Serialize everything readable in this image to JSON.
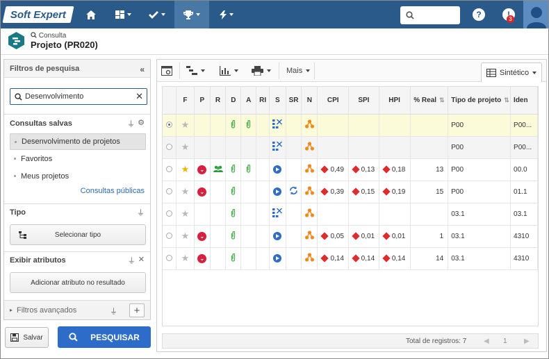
{
  "brand": {
    "logo_text": "Soft Expert"
  },
  "topnav": {
    "items": [
      {
        "icon": "home-icon"
      },
      {
        "icon": "dashboard-icon"
      },
      {
        "icon": "check-icon"
      },
      {
        "icon": "trophy-icon"
      },
      {
        "icon": "lightning-icon"
      }
    ],
    "notification_count": "3"
  },
  "header": {
    "breadcrumb": "Consulta",
    "title": "Projeto (PR020)"
  },
  "left": {
    "title": "Filtros de pesquisa",
    "search_value": "Desenvolvimento",
    "saved_title": "Consultas salvas",
    "saved_items": [
      "Desenvolvimento de projetos",
      "Favoritos",
      "Meus projetos"
    ],
    "public_link": "Consultas públicas",
    "tipo_title": "Tipo",
    "select_type": "Selecionar tipo",
    "attr_title": "Exibir atributos",
    "add_attr": "Adicionar atributo no resultado",
    "advanced": "Filtros avançados",
    "save": "Salvar",
    "search": "PESQUISAR"
  },
  "toolbar": {
    "more": "Mais",
    "view": "Sintético"
  },
  "table": {
    "columns": [
      "",
      "F",
      "P",
      "R",
      "D",
      "A",
      "RI",
      "S",
      "SR",
      "N",
      "CPI",
      "SPI",
      "HPI",
      "% Real",
      "Tipo de projeto",
      "Iden"
    ],
    "rows": [
      {
        "sel": true,
        "star": false,
        "p": false,
        "r": false,
        "d": true,
        "a": true,
        "s": "grid",
        "sr": false,
        "n": true,
        "cpi": "",
        "spi": "",
        "hpi": "",
        "real": "",
        "tipo": "P00",
        "iden": "P00..."
      },
      {
        "sel": false,
        "star": false,
        "p": false,
        "r": false,
        "d": false,
        "a": false,
        "s": "grid",
        "sr": false,
        "n": true,
        "cpi": "",
        "spi": "",
        "hpi": "",
        "real": "",
        "tipo": "P00",
        "iden": "P00..."
      },
      {
        "sel": false,
        "star": true,
        "p": true,
        "r": true,
        "d": true,
        "a": true,
        "s": "play",
        "sr": false,
        "n": true,
        "cpi": "0,49",
        "spi": "0,13",
        "hpi": "0,18",
        "real": "13",
        "tipo": "P00",
        "iden": "00.0"
      },
      {
        "sel": false,
        "star": false,
        "p": true,
        "r": false,
        "d": true,
        "a": false,
        "s": "play",
        "sr": true,
        "n": true,
        "cpi": "0,39",
        "spi": "0,15",
        "hpi": "0,19",
        "real": "15",
        "tipo": "P00",
        "iden": "01.1"
      },
      {
        "sel": false,
        "star": false,
        "p": false,
        "r": false,
        "d": true,
        "a": false,
        "s": "grid",
        "sr": false,
        "n": true,
        "cpi": "",
        "spi": "",
        "hpi": "",
        "real": "",
        "tipo": "03.1",
        "iden": "03.1"
      },
      {
        "sel": false,
        "star": false,
        "p": true,
        "r": false,
        "d": true,
        "a": false,
        "s": "play",
        "sr": false,
        "n": true,
        "cpi": "0,05",
        "spi": "0,01",
        "hpi": "0,01",
        "real": "1",
        "tipo": "03.1",
        "iden": "4310"
      },
      {
        "sel": false,
        "star": false,
        "p": true,
        "r": false,
        "d": true,
        "a": false,
        "s": "play",
        "sr": false,
        "n": true,
        "cpi": "0,14",
        "spi": "0,14",
        "hpi": "0,14",
        "real": "14",
        "tipo": "03.1",
        "iden": "4310"
      }
    ]
  },
  "footer": {
    "total": "Total de registros: 7",
    "page": "1"
  },
  "colors": {
    "brand": "#2a5a89",
    "primary_button": "#2e6cc9",
    "status_red": "#d71f3f",
    "orange": "#f08a1c",
    "green": "#4caf50"
  }
}
